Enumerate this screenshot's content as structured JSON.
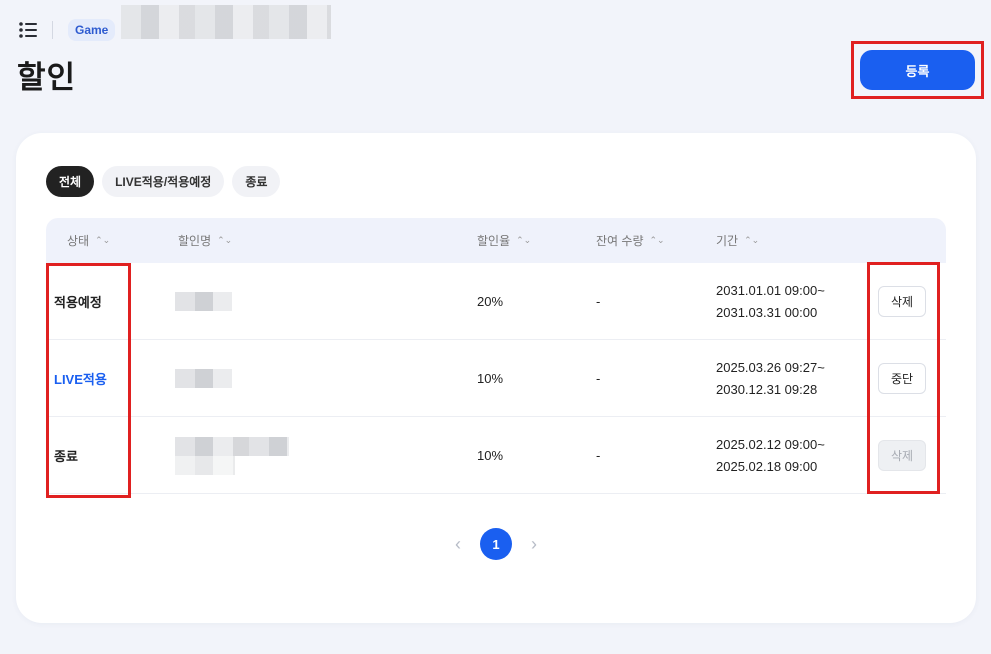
{
  "header": {
    "game_tag": "Game",
    "title": "할인",
    "register_label": "등록"
  },
  "filters": [
    {
      "label": "전체",
      "active": true
    },
    {
      "label": "LIVE적용/적용예정",
      "active": false
    },
    {
      "label": "종료",
      "active": false
    }
  ],
  "table": {
    "columns": [
      "상태",
      "할인명",
      "할인율",
      "잔여 수량",
      "기간"
    ],
    "sort_icon": "⌃⌄",
    "rows": [
      {
        "status": "적용예정",
        "rate": "20%",
        "remaining": "-",
        "period_start": "2031.01.01 09:00~",
        "period_end": "2031.03.31 00:00",
        "action": "삭제",
        "action_enabled": true
      },
      {
        "status": "LIVE적용",
        "rate": "10%",
        "remaining": "-",
        "period_start": "2025.03.26 09:27~",
        "period_end": "2030.12.31 09:28",
        "action": "중단",
        "action_enabled": true
      },
      {
        "status": "종료",
        "rate": "10%",
        "remaining": "-",
        "period_start": "2025.02.12 09:00~",
        "period_end": "2025.02.18 09:00",
        "action": "삭제",
        "action_enabled": false
      }
    ]
  },
  "pagination": {
    "prev": "‹",
    "current": "1",
    "next": "›"
  },
  "colors": {
    "accent": "#1a5ff0",
    "highlight": "#e02020",
    "live_status": "#1a5ff0"
  }
}
